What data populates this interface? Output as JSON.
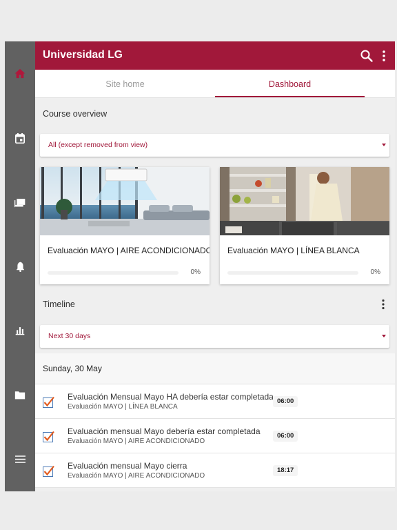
{
  "app": {
    "title": "Universidad LG"
  },
  "colors": {
    "brand": "#a1183a",
    "rail": "#616161"
  },
  "nav_rail": {
    "items": [
      {
        "icon": "home-icon",
        "active": true
      },
      {
        "icon": "calendar-icon",
        "active": false
      },
      {
        "icon": "messages-icon",
        "active": false
      },
      {
        "icon": "notifications-icon",
        "active": false
      },
      {
        "icon": "grades-icon",
        "active": false
      },
      {
        "icon": "folder-icon",
        "active": false
      },
      {
        "icon": "menu-icon",
        "active": false
      }
    ]
  },
  "tabs": [
    {
      "label": "Site home",
      "active": false
    },
    {
      "label": "Dashboard",
      "active": true
    }
  ],
  "course_overview": {
    "title": "Course overview",
    "filter": "All (except removed from view)",
    "courses": [
      {
        "name": "Evaluación MAYO | AIRE ACONDICIONADO",
        "progress": "0%",
        "progress_value": 0
      },
      {
        "name": "Evaluación MAYO | LÍNEA BLANCA",
        "progress": "0%",
        "progress_value": 0
      }
    ]
  },
  "timeline": {
    "title": "Timeline",
    "filter": "Next 30 days",
    "day": "Sunday, 30 May",
    "events": [
      {
        "title": "Evaluación Mensual Mayo HA debería estar completada",
        "course": "Evaluación MAYO | LÍNEA BLANCA",
        "time": "06:00",
        "icon": "assignment-check-icon"
      },
      {
        "title": "Evaluación mensual Mayo debería estar completada",
        "course": "Evaluación MAYO | AIRE ACONDICIONADO",
        "time": "06:00",
        "icon": "assignment-check-icon"
      },
      {
        "title": "Evaluación mensual Mayo cierra",
        "course": "Evaluación MAYO | AIRE ACONDICIONADO",
        "time": "18:17",
        "icon": "assignment-check-icon"
      }
    ]
  }
}
